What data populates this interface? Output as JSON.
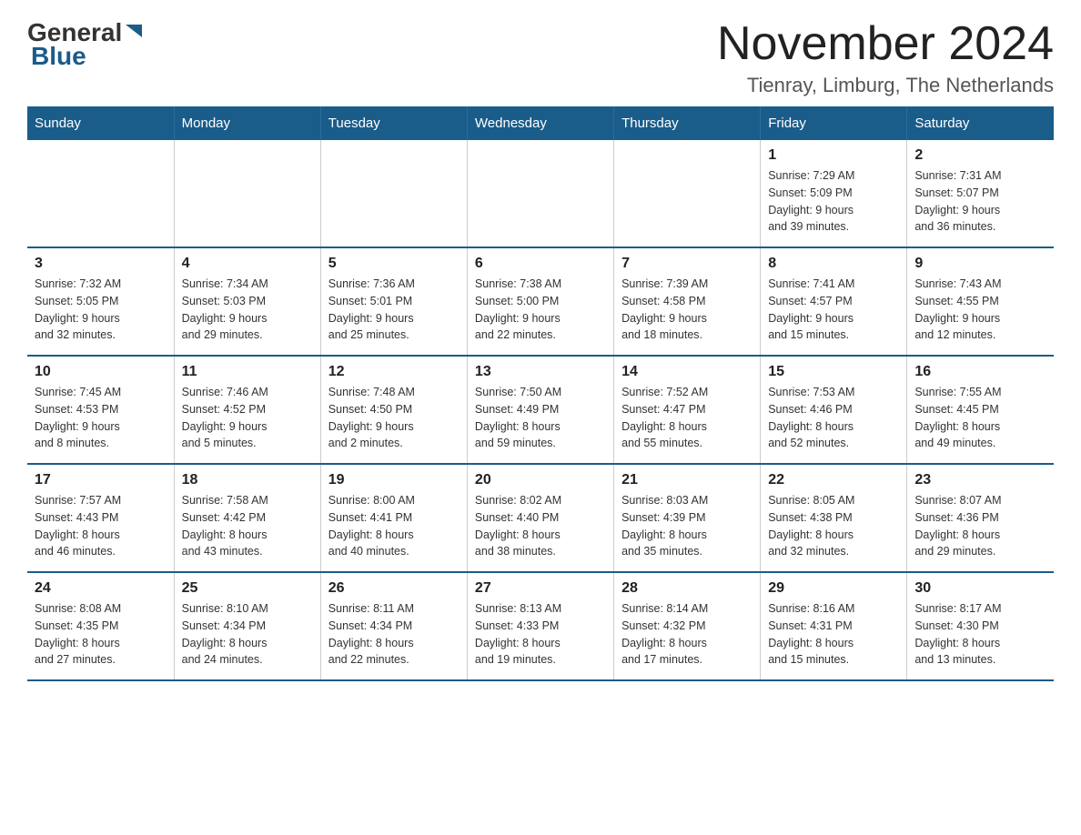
{
  "header": {
    "logo_general": "General",
    "logo_blue": "Blue",
    "month_year": "November 2024",
    "location": "Tienray, Limburg, The Netherlands"
  },
  "days_of_week": [
    "Sunday",
    "Monday",
    "Tuesday",
    "Wednesday",
    "Thursday",
    "Friday",
    "Saturday"
  ],
  "weeks": [
    {
      "days": [
        {
          "num": "",
          "info": ""
        },
        {
          "num": "",
          "info": ""
        },
        {
          "num": "",
          "info": ""
        },
        {
          "num": "",
          "info": ""
        },
        {
          "num": "",
          "info": ""
        },
        {
          "num": "1",
          "info": "Sunrise: 7:29 AM\nSunset: 5:09 PM\nDaylight: 9 hours\nand 39 minutes."
        },
        {
          "num": "2",
          "info": "Sunrise: 7:31 AM\nSunset: 5:07 PM\nDaylight: 9 hours\nand 36 minutes."
        }
      ]
    },
    {
      "days": [
        {
          "num": "3",
          "info": "Sunrise: 7:32 AM\nSunset: 5:05 PM\nDaylight: 9 hours\nand 32 minutes."
        },
        {
          "num": "4",
          "info": "Sunrise: 7:34 AM\nSunset: 5:03 PM\nDaylight: 9 hours\nand 29 minutes."
        },
        {
          "num": "5",
          "info": "Sunrise: 7:36 AM\nSunset: 5:01 PM\nDaylight: 9 hours\nand 25 minutes."
        },
        {
          "num": "6",
          "info": "Sunrise: 7:38 AM\nSunset: 5:00 PM\nDaylight: 9 hours\nand 22 minutes."
        },
        {
          "num": "7",
          "info": "Sunrise: 7:39 AM\nSunset: 4:58 PM\nDaylight: 9 hours\nand 18 minutes."
        },
        {
          "num": "8",
          "info": "Sunrise: 7:41 AM\nSunset: 4:57 PM\nDaylight: 9 hours\nand 15 minutes."
        },
        {
          "num": "9",
          "info": "Sunrise: 7:43 AM\nSunset: 4:55 PM\nDaylight: 9 hours\nand 12 minutes."
        }
      ]
    },
    {
      "days": [
        {
          "num": "10",
          "info": "Sunrise: 7:45 AM\nSunset: 4:53 PM\nDaylight: 9 hours\nand 8 minutes."
        },
        {
          "num": "11",
          "info": "Sunrise: 7:46 AM\nSunset: 4:52 PM\nDaylight: 9 hours\nand 5 minutes."
        },
        {
          "num": "12",
          "info": "Sunrise: 7:48 AM\nSunset: 4:50 PM\nDaylight: 9 hours\nand 2 minutes."
        },
        {
          "num": "13",
          "info": "Sunrise: 7:50 AM\nSunset: 4:49 PM\nDaylight: 8 hours\nand 59 minutes."
        },
        {
          "num": "14",
          "info": "Sunrise: 7:52 AM\nSunset: 4:47 PM\nDaylight: 8 hours\nand 55 minutes."
        },
        {
          "num": "15",
          "info": "Sunrise: 7:53 AM\nSunset: 4:46 PM\nDaylight: 8 hours\nand 52 minutes."
        },
        {
          "num": "16",
          "info": "Sunrise: 7:55 AM\nSunset: 4:45 PM\nDaylight: 8 hours\nand 49 minutes."
        }
      ]
    },
    {
      "days": [
        {
          "num": "17",
          "info": "Sunrise: 7:57 AM\nSunset: 4:43 PM\nDaylight: 8 hours\nand 46 minutes."
        },
        {
          "num": "18",
          "info": "Sunrise: 7:58 AM\nSunset: 4:42 PM\nDaylight: 8 hours\nand 43 minutes."
        },
        {
          "num": "19",
          "info": "Sunrise: 8:00 AM\nSunset: 4:41 PM\nDaylight: 8 hours\nand 40 minutes."
        },
        {
          "num": "20",
          "info": "Sunrise: 8:02 AM\nSunset: 4:40 PM\nDaylight: 8 hours\nand 38 minutes."
        },
        {
          "num": "21",
          "info": "Sunrise: 8:03 AM\nSunset: 4:39 PM\nDaylight: 8 hours\nand 35 minutes."
        },
        {
          "num": "22",
          "info": "Sunrise: 8:05 AM\nSunset: 4:38 PM\nDaylight: 8 hours\nand 32 minutes."
        },
        {
          "num": "23",
          "info": "Sunrise: 8:07 AM\nSunset: 4:36 PM\nDaylight: 8 hours\nand 29 minutes."
        }
      ]
    },
    {
      "days": [
        {
          "num": "24",
          "info": "Sunrise: 8:08 AM\nSunset: 4:35 PM\nDaylight: 8 hours\nand 27 minutes."
        },
        {
          "num": "25",
          "info": "Sunrise: 8:10 AM\nSunset: 4:34 PM\nDaylight: 8 hours\nand 24 minutes."
        },
        {
          "num": "26",
          "info": "Sunrise: 8:11 AM\nSunset: 4:34 PM\nDaylight: 8 hours\nand 22 minutes."
        },
        {
          "num": "27",
          "info": "Sunrise: 8:13 AM\nSunset: 4:33 PM\nDaylight: 8 hours\nand 19 minutes."
        },
        {
          "num": "28",
          "info": "Sunrise: 8:14 AM\nSunset: 4:32 PM\nDaylight: 8 hours\nand 17 minutes."
        },
        {
          "num": "29",
          "info": "Sunrise: 8:16 AM\nSunset: 4:31 PM\nDaylight: 8 hours\nand 15 minutes."
        },
        {
          "num": "30",
          "info": "Sunrise: 8:17 AM\nSunset: 4:30 PM\nDaylight: 8 hours\nand 13 minutes."
        }
      ]
    }
  ]
}
